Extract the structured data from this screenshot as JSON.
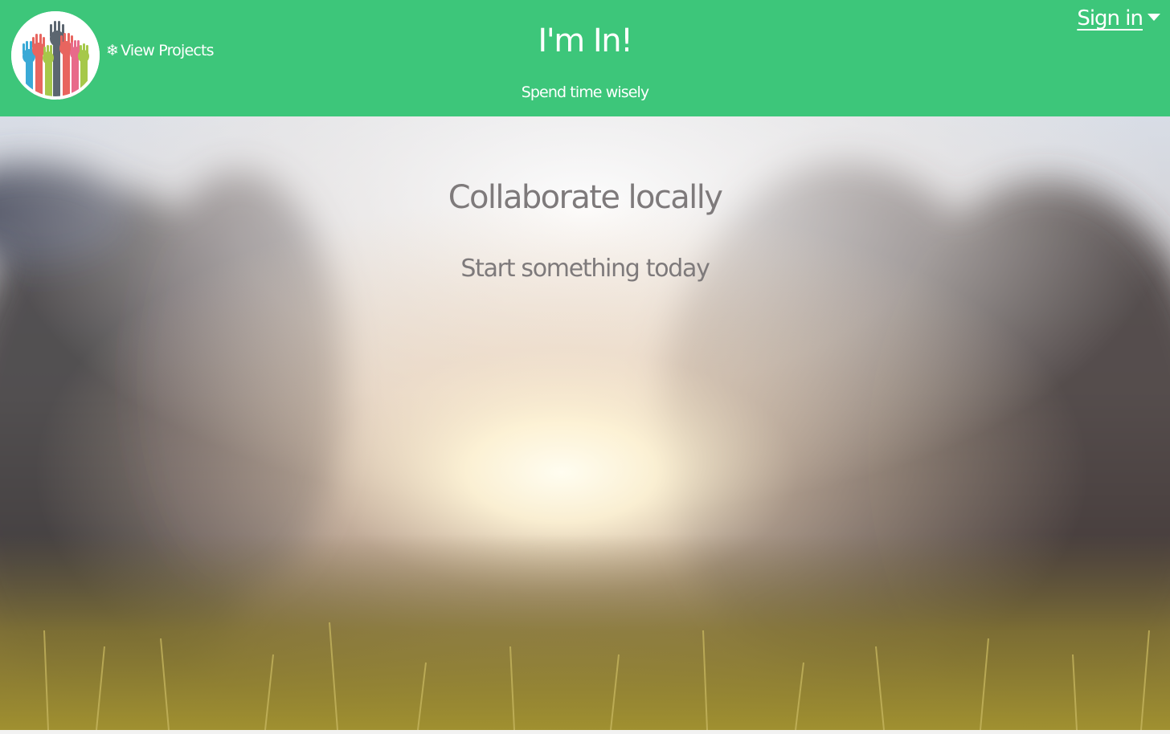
{
  "header": {
    "background_color": "#3dc67a",
    "logo_icon": "raised-hands-logo-icon",
    "nav": {
      "projects_icon": "snowflake-icon",
      "projects_glyph": "❄",
      "projects_label": "View Projects"
    },
    "title": "I'm In!",
    "tagline": "Spend time wisely",
    "signin": {
      "label": "Sign in",
      "icon": "caret-down-icon"
    }
  },
  "hero": {
    "background_image": "blurred sunlit trees over grass",
    "title": "Collaborate locally",
    "subtitle": "Start something today",
    "text_color": "#7e7a7b"
  }
}
